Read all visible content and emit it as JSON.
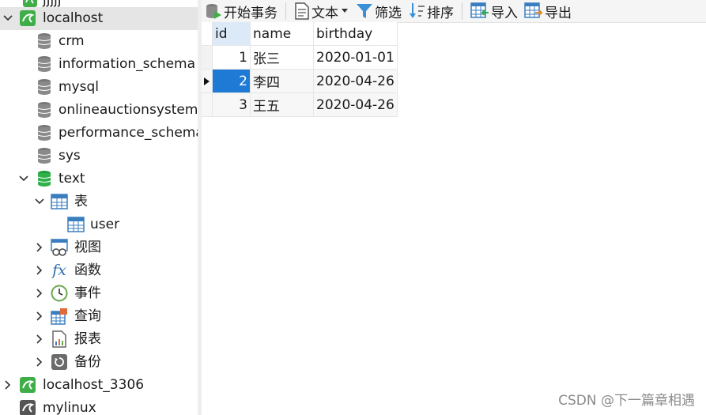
{
  "sidebar": {
    "top_partial_label": "jjjjj",
    "connections": [
      {
        "label": "localhost"
      },
      {
        "label": "localhost_3306"
      },
      {
        "label": "mylinux"
      }
    ],
    "databases": [
      {
        "label": "crm"
      },
      {
        "label": "information_schema"
      },
      {
        "label": "mysql"
      },
      {
        "label": "onlineauctionsystem"
      },
      {
        "label": "performance_schema"
      },
      {
        "label": "sys"
      },
      {
        "label": "text"
      }
    ],
    "text_children": {
      "tables": "表",
      "table_items": [
        "user"
      ],
      "views": "视图",
      "functions": "函数",
      "events": "事件",
      "queries": "查询",
      "reports": "报表",
      "backups": "备份"
    }
  },
  "toolbar": {
    "begin_transaction": "开始事务",
    "text": "文本",
    "filter": "筛选",
    "sort": "排序",
    "import": "导入",
    "export": "导出"
  },
  "grid": {
    "columns": [
      "id",
      "name",
      "birthday"
    ],
    "rows": [
      [
        "1",
        "张三",
        "2020-01-01"
      ],
      [
        "2",
        "李四",
        "2020-04-26"
      ],
      [
        "3",
        "王五",
        "2020-04-26"
      ]
    ]
  },
  "watermark": "CSDN @下一篇章相遇",
  "colors": {
    "selection": "#1f7ad6",
    "mysql_green": "#3fae49",
    "header_highlight": "#dce9f7"
  }
}
